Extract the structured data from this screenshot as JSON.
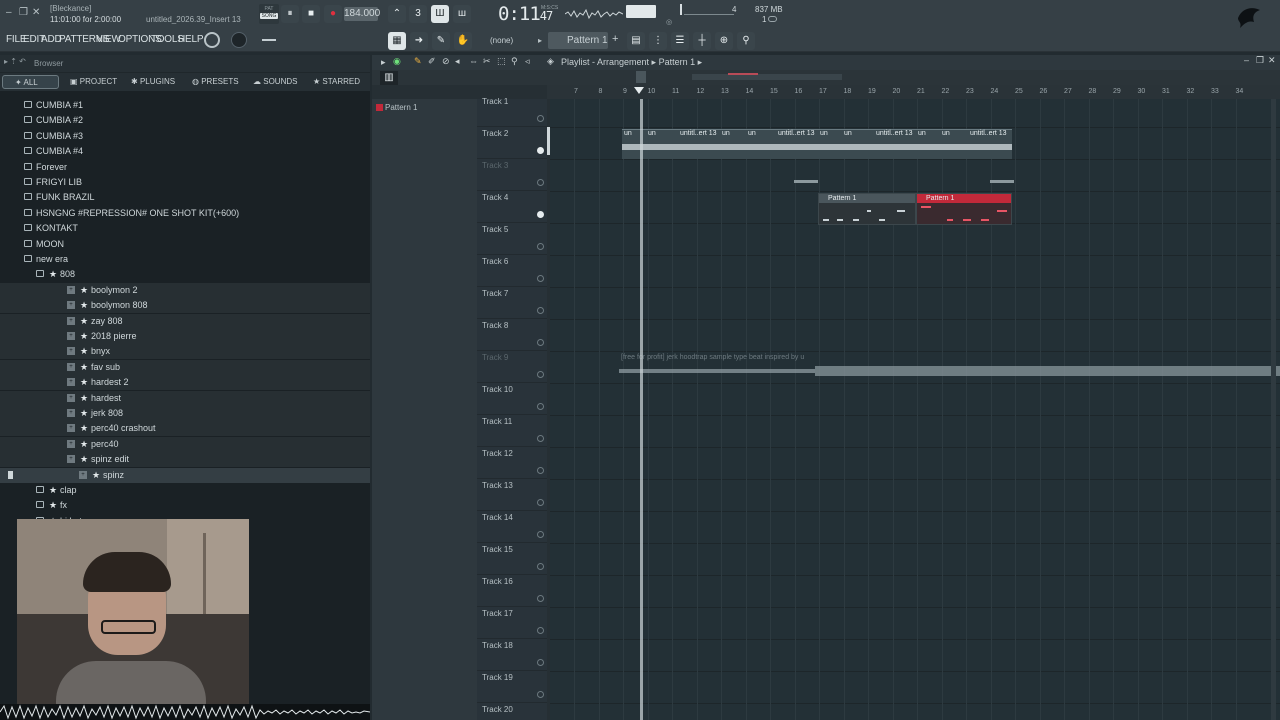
{
  "window": {
    "project_user": "[Bleckance]",
    "song_position": "11:01:00 for 2:00:00",
    "project_file": "untitled_2026.39_Insert 13",
    "tempo": "184.000",
    "clock": "0:11",
    "clock_small": "47",
    "clock_unit": "M:S:CS",
    "cpu_top": "4",
    "memory": "837 MB",
    "polyphony": "1",
    "pattern_mode": "PAT",
    "song_mode": "SONG"
  },
  "menu": [
    "FILE",
    "EDIT",
    "ADD",
    "PATTERNS",
    "VIEW",
    "OPTIONS",
    "TOOLS",
    "HELP"
  ],
  "toolbar": {
    "snap": "(none)",
    "pattern": "Pattern 1"
  },
  "browser": {
    "title": "Browser",
    "tabs": [
      "ALL",
      "PROJECT",
      "PLUGINS",
      "PRESETS",
      "SOUNDS",
      "STARRED"
    ],
    "tree": [
      {
        "label": "CUMBIA #1",
        "type": "folder",
        "indent": 0
      },
      {
        "label": "CUMBIA #2",
        "type": "folder",
        "indent": 0
      },
      {
        "label": "CUMBIA #3",
        "type": "folder",
        "indent": 0
      },
      {
        "label": "CUMBIA #4",
        "type": "folder",
        "indent": 0
      },
      {
        "label": "Forever",
        "type": "folder",
        "indent": 0
      },
      {
        "label": "FRIGYI LIB",
        "type": "folder",
        "indent": 0
      },
      {
        "label": "FUNK BRAZIL",
        "type": "folder",
        "indent": 0
      },
      {
        "label": "HSNGNG #REPRESSION# ONE SHOT KIT(+600)",
        "type": "folder",
        "indent": 0
      },
      {
        "label": "KONTAKT",
        "type": "folder",
        "indent": 0
      },
      {
        "label": "MOON",
        "type": "folder",
        "indent": 0
      },
      {
        "label": "new era",
        "type": "folder-open",
        "indent": 0
      },
      {
        "label": "808",
        "type": "star-folder",
        "indent": 1
      },
      {
        "label": "boolymon 2",
        "type": "star",
        "indent": 2
      },
      {
        "label": "boolymon 808",
        "type": "star",
        "indent": 2
      },
      {
        "label": "zay 808",
        "type": "star",
        "indent": 2
      },
      {
        "label": "2018 pierre",
        "type": "star",
        "indent": 2
      },
      {
        "label": "bnyx",
        "type": "star",
        "indent": 2
      },
      {
        "label": "fav sub",
        "type": "star",
        "indent": 2
      },
      {
        "label": "hardest 2",
        "type": "star",
        "indent": 2
      },
      {
        "label": "hardest",
        "type": "star",
        "indent": 2
      },
      {
        "label": "jerk 808",
        "type": "star",
        "indent": 2
      },
      {
        "label": "perc40 crashout",
        "type": "star",
        "indent": 2
      },
      {
        "label": "perc40",
        "type": "star",
        "indent": 2
      },
      {
        "label": "spinz edit",
        "type": "star",
        "indent": 2
      },
      {
        "label": "spinz",
        "type": "star",
        "indent": 3
      },
      {
        "label": "clap",
        "type": "star-folder",
        "indent": 1
      },
      {
        "label": "fx",
        "type": "star-folder",
        "indent": 1
      },
      {
        "label": "hi hat",
        "type": "star-folder",
        "indent": 1
      }
    ]
  },
  "playlist": {
    "title": "Playlist - Arrangement",
    "breadcrumb": "Pattern 1",
    "pattern_list": [
      "Pattern 1"
    ],
    "ruler": [
      "7",
      "8",
      "9",
      "10",
      "11",
      "12",
      "13",
      "14",
      "15",
      "16",
      "17",
      "18",
      "19",
      "20",
      "21",
      "22",
      "23",
      "24",
      "25",
      "26",
      "27",
      "28",
      "29",
      "30",
      "31",
      "32",
      "33",
      "34"
    ],
    "tracks": [
      "Track 1",
      "Track 2",
      "Track 3",
      "Track 4",
      "Track 5",
      "Track 6",
      "Track 7",
      "Track 8",
      "Track 9",
      "Track 10",
      "Track 11",
      "Track 12",
      "Track 13",
      "Track 14",
      "Track 15",
      "Track 16",
      "Track 17",
      "Track 18",
      "Track 19",
      "Track 20"
    ],
    "audio_clip_label": "untitl..ert 13",
    "audio_clip_short": "un",
    "pattern_clip": "Pattern 1",
    "sample_clip": "[free for profit] jerk  hoodtrap  sample type beat inspired by u",
    "colors": {
      "red_clip": "#c2293a",
      "grid_bg": "#233036"
    }
  }
}
